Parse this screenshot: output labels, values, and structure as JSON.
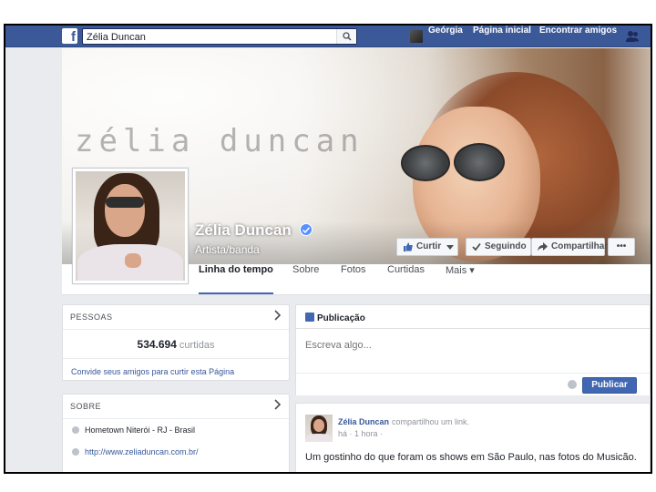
{
  "topbar": {
    "logo": "f",
    "search_value": "Zélia Duncan",
    "profile_name": "Geórgia",
    "home_label": "Página inicial",
    "friends_label": "Encontrar amigos"
  },
  "cover": {
    "overlay_text": "zélia duncan"
  },
  "page": {
    "name": "Zélia Duncan",
    "category": "Artista/banda"
  },
  "actions": {
    "like": "Curtir",
    "following": "Seguindo",
    "share": "Compartilhar",
    "more": "•••"
  },
  "tabs": {
    "timeline": "Linha do tempo",
    "about": "Sobre",
    "photos": "Fotos",
    "likes": "Curtidas",
    "more": "Mais ▾"
  },
  "people": {
    "header": "PESSOAS",
    "likes_count": "534.694",
    "likes_unit": "curtidas",
    "invite": "Convide seus amigos para curtir esta Página"
  },
  "about": {
    "header": "SOBRE",
    "hometown": "Hometown Niterói - RJ - Brasil",
    "website": "http://www.zeliaduncan.com.br/"
  },
  "composer": {
    "tab": "Publicação",
    "placeholder": "Escreva algo...",
    "publish": "Publicar"
  },
  "post": {
    "author": "Zélia Duncan",
    "action": "compartilhou um link.",
    "time": "há · 1 hora ·",
    "text": "Um gostinho do que foram os shows em São Paulo, nas fotos do Musicão."
  },
  "colors": {
    "brand": "#3b5998",
    "link": "#365899",
    "button_primary": "#4267b2"
  }
}
